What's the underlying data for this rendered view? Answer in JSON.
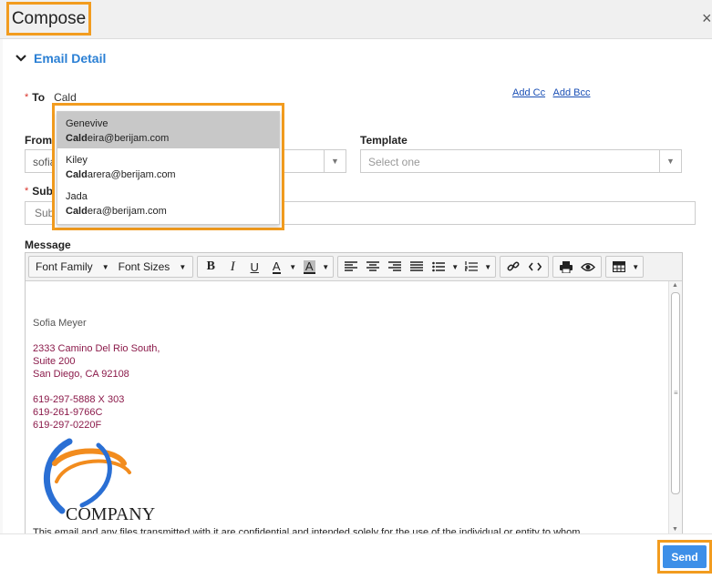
{
  "dialog": {
    "title": "Compose",
    "close_glyph": "×"
  },
  "section": {
    "title": "Email Detail"
  },
  "to": {
    "required": "*",
    "label": "To",
    "value": "Cald",
    "add_cc": "Add Cc",
    "add_bcc": "Add Bcc"
  },
  "suggestions": [
    {
      "name": "Genevive",
      "match": "Cald",
      "rest": "eira@berijam.com",
      "active": true
    },
    {
      "name": "Kiley",
      "match": "Cald",
      "rest": "arera@berijam.com",
      "active": false
    },
    {
      "name": "Jada",
      "match": "Cald",
      "rest": "era@berijam.com",
      "active": false
    }
  ],
  "from": {
    "label": "From",
    "value": "sofia"
  },
  "template": {
    "label": "Template",
    "value": "Select one"
  },
  "subject": {
    "required": "*",
    "label": "Sub",
    "placeholder": "Sub"
  },
  "message": {
    "label": "Message"
  },
  "toolbar": {
    "font_family": "Font Family",
    "font_sizes": "Font Sizes",
    "bold": "B",
    "italic": "I",
    "underline": "U",
    "text_color": "A",
    "bg_color": "A"
  },
  "signature": {
    "name": "Sofia Meyer",
    "address_1": "2333 Camino Del Rio South,",
    "address_2": "Suite 200",
    "address_3": "San Diego, CA 92108",
    "phone_1": "619-297-5888 X 303",
    "phone_2": "619-261-9766C",
    "phone_3": "619-297-0220F",
    "logo_text": "COMPANY",
    "disclaimer": "This email and any files transmitted with it are confidential and intended solely for the use of the individual or entity to whom"
  },
  "footer": {
    "send_label": "Send"
  },
  "colors": {
    "accent_orange": "#f29c1f",
    "link_blue": "#2a7fd4",
    "send_blue": "#3d8fe8",
    "signature_red": "#8b1a4a"
  }
}
